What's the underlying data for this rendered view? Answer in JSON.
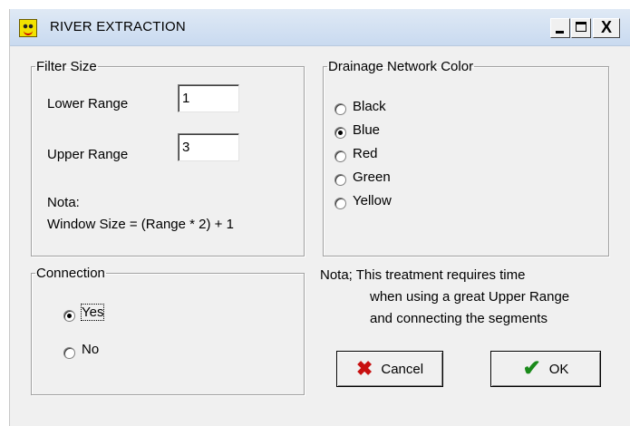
{
  "window": {
    "title": "RIVER EXTRACTION",
    "controls": {
      "minimize": "_",
      "maximize": "□",
      "close": "X"
    },
    "icon": "app-face-icon"
  },
  "filter_size": {
    "legend": "Filter Size",
    "lower_label": "Lower Range",
    "lower_value": "1",
    "upper_label": "Upper Range",
    "upper_value": "3",
    "note_title": "Nota:",
    "note_text": "Window Size = (Range * 2) + 1"
  },
  "drainage_color": {
    "legend": "Drainage Network Color",
    "options": [
      "Black",
      "Blue",
      "Red",
      "Green",
      "Yellow"
    ],
    "selected": "Blue"
  },
  "connection": {
    "legend": "Connection",
    "options": [
      "Yes",
      "No"
    ],
    "selected": "Yes"
  },
  "note": {
    "line1": "Nota; This treatment requires time",
    "line2": "when using a great Upper Range",
    "line3": "and connecting the segments"
  },
  "buttons": {
    "cancel_label": "Cancel",
    "cancel_icon": "red-x-icon",
    "ok_label": "OK",
    "ok_icon": "green-check-icon"
  },
  "colors": {
    "titlebar": "#c9daf0",
    "dialog_bg": "#f0f0f0",
    "cancel_icon": "#c81010",
    "ok_icon": "#1a8a1a"
  }
}
